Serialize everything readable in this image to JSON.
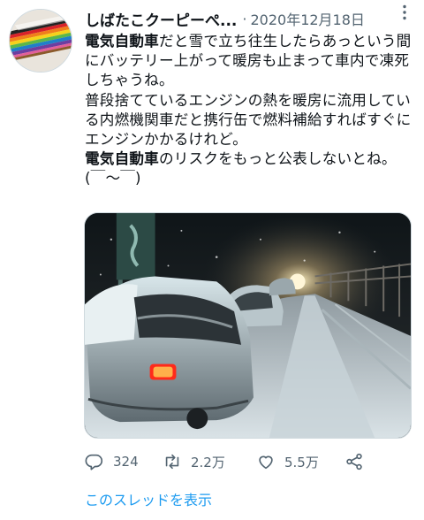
{
  "tweet": {
    "display_name": "しばたこクーピーぺ...",
    "separator": "·",
    "date": "2020年12月18日",
    "paragraph1": {
      "bold": "電気自動車",
      "rest": "だと雪で立ち往生したらあっという間にバッテリー上がって暖房も止まって車内で凍死しちゃうね。"
    },
    "paragraph2": {
      "line1": "普段捨てているエンジンの熱を暖房に流用している内燃機関車だと携行缶で燃料補給すればすぐにエンジンかかるけれど。"
    },
    "paragraph3": {
      "bold": "電気自動車",
      "rest": "のリスクをもっと公表しないとね。(￣～￣)"
    },
    "actions": {
      "replies": "324",
      "retweets": "2.2万",
      "likes": "5.5万"
    },
    "thread_link": "このスレッドを表示"
  },
  "icons": {
    "more": "more-vertical-icon",
    "reply": "reply-icon",
    "retweet": "retweet-icon",
    "like": "heart-icon",
    "share": "share-icon"
  },
  "colors": {
    "text": "#0f1419",
    "muted": "#536471",
    "link": "#1d9bf0"
  }
}
